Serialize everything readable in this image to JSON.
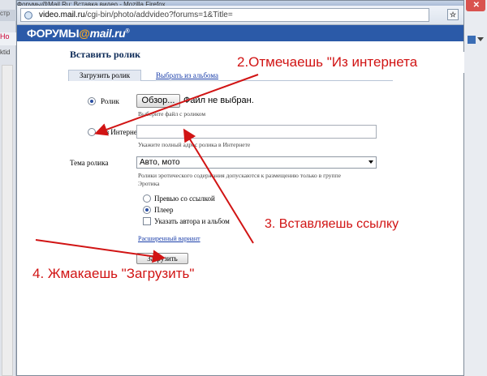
{
  "browser": {
    "title": "Форумы@Mail.Ru: Вставка видео - Mozilla Firefox",
    "url_host": "video.mail.ru",
    "url_path": "/cgi-bin/photo/addvideo?forums=1&Title=",
    "bg_tab1": "стр",
    "bg_tab2": "Но",
    "bg_tab3": "ktid"
  },
  "brand": {
    "name": "ФОРУМЫ",
    "at": "@",
    "domain": "mail.ru",
    "reg": "®"
  },
  "form": {
    "heading": "Вставить ролик",
    "tab_upload": "Загрузить ролик",
    "tab_album": "Выбрать из альбома",
    "source_file_label": "Ролик",
    "browse_label": "Обзор...",
    "no_file_text": "Файл не выбран.",
    "file_hint": "Выберите файл с роликом",
    "source_internet_label": "Из Интернета",
    "internet_hint": "Укажите полный адрес ролика в Интернете",
    "topic_label": "Тема ролика",
    "topic_value": "Авто, мото",
    "topic_hint_line1": "Ролики эротического содержания допускаются к размещению только в группе",
    "topic_hint_line2": "Эротика",
    "preview_option": "Превью со ссылкой",
    "player_option": "Плеер",
    "author_option": "Указать автора и альбом",
    "advanced_link": "Расширенный вариант",
    "submit_label": "Загрузить"
  },
  "annotations": {
    "step2": "2.Отмечаешь \"Из интернета",
    "step3": "3. Вставляешь ссылку",
    "step4": "4. Жмакаешь  \"Загрузить\"",
    "color": "#d11414"
  }
}
